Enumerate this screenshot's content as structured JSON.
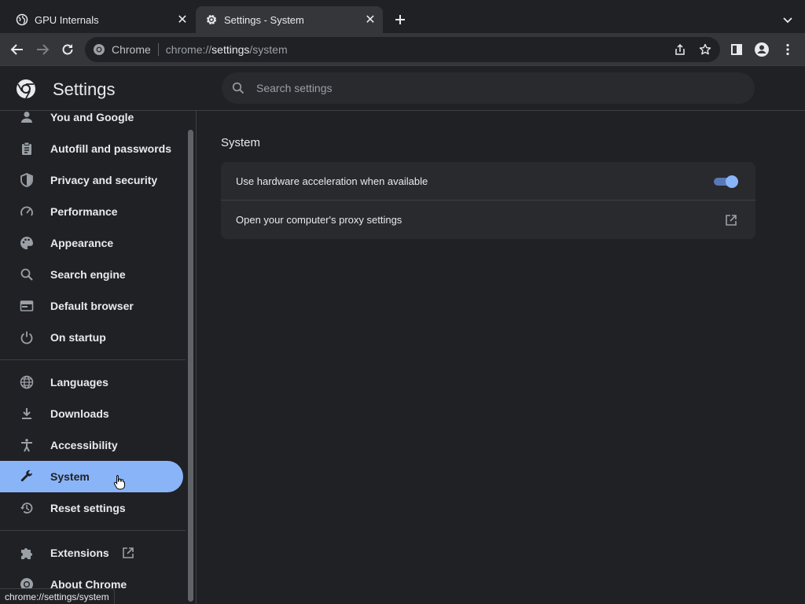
{
  "tabs": [
    {
      "title": "GPU Internals",
      "icon": "globe-icon",
      "active": false
    },
    {
      "title": "Settings - System",
      "icon": "gear-icon",
      "active": true
    }
  ],
  "omnibox": {
    "chip": "Chrome",
    "scheme": "chrome://",
    "host": "settings",
    "path": "/system"
  },
  "header": {
    "title": "Settings",
    "search_placeholder": "Search settings"
  },
  "sidebar": {
    "items": [
      {
        "label": "You and Google",
        "icon": "person-icon"
      },
      {
        "label": "Autofill and passwords",
        "icon": "clipboard-icon"
      },
      {
        "label": "Privacy and security",
        "icon": "shield-icon"
      },
      {
        "label": "Performance",
        "icon": "speedometer-icon"
      },
      {
        "label": "Appearance",
        "icon": "palette-icon"
      },
      {
        "label": "Search engine",
        "icon": "search-icon"
      },
      {
        "label": "Default browser",
        "icon": "browser-window-icon"
      },
      {
        "label": "On startup",
        "icon": "power-icon"
      },
      {
        "label": "Languages",
        "icon": "globe-icon"
      },
      {
        "label": "Downloads",
        "icon": "download-icon"
      },
      {
        "label": "Accessibility",
        "icon": "accessibility-icon"
      },
      {
        "label": "System",
        "icon": "wrench-icon",
        "selected": true
      },
      {
        "label": "Reset settings",
        "icon": "history-icon"
      },
      {
        "label": "Extensions",
        "icon": "puzzle-icon"
      },
      {
        "label": "About Chrome",
        "icon": "chrome-icon"
      }
    ]
  },
  "main": {
    "section_title": "System",
    "rows": [
      {
        "label": "Use hardware acceleration when available",
        "control": "toggle",
        "checked": true
      },
      {
        "label": "Open your computer's proxy settings",
        "control": "external-link"
      }
    ]
  },
  "status_bar": "chrome://settings/system",
  "colors": {
    "background": "#202124",
    "toolbar": "#35363a",
    "accent": "#8ab4f8",
    "card": "#292a2d"
  }
}
